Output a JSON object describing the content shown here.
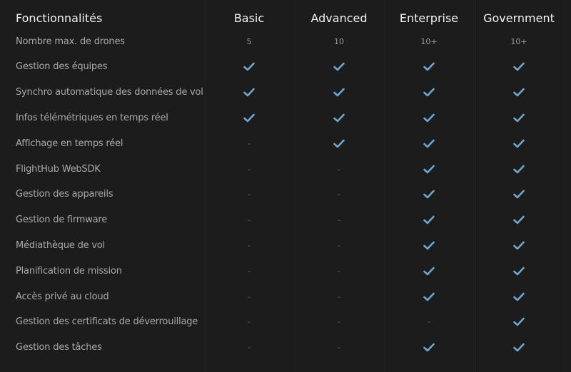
{
  "header": {
    "feature_label": "Fonctionnalités",
    "plans": [
      "Basic",
      "Advanced",
      "Enterprise",
      "Government"
    ]
  },
  "colors": {
    "check": "#6fa6cf",
    "background": "#1c1c1d"
  },
  "rows": [
    {
      "feature": "Nombre max. de drones",
      "values": [
        "5",
        "10",
        "10+",
        "10+"
      ]
    },
    {
      "feature": "Gestion des équipes",
      "values": [
        "check",
        "check",
        "check",
        "check"
      ]
    },
    {
      "feature": "Synchro automatique des données de vol",
      "values": [
        "check",
        "check",
        "check",
        "check"
      ]
    },
    {
      "feature": "Infos télémétriques en temps réel",
      "values": [
        "check",
        "check",
        "check",
        "check"
      ]
    },
    {
      "feature": "Affichage en temps réel",
      "values": [
        "-",
        "check",
        "check",
        "check"
      ]
    },
    {
      "feature": "FlightHub WebSDK",
      "values": [
        "-",
        "-",
        "check",
        "check"
      ]
    },
    {
      "feature": "Gestion des appareils",
      "values": [
        "-",
        "-",
        "check",
        "check"
      ]
    },
    {
      "feature": "Gestion de firmware",
      "values": [
        "-",
        "-",
        "check",
        "check"
      ]
    },
    {
      "feature": "Médiathèque de vol",
      "values": [
        "-",
        "-",
        "check",
        "check"
      ]
    },
    {
      "feature": "Planification de mission",
      "values": [
        "-",
        "-",
        "check",
        "check"
      ]
    },
    {
      "feature": "Accès privé au cloud",
      "values": [
        "-",
        "-",
        "check",
        "check"
      ]
    },
    {
      "feature": "Gestion des certificats de déverrouillage",
      "values": [
        "-",
        "-",
        "-",
        "check"
      ]
    },
    {
      "feature": "Gestion des tâches",
      "values": [
        "-",
        "-",
        "check",
        "check"
      ]
    }
  ]
}
